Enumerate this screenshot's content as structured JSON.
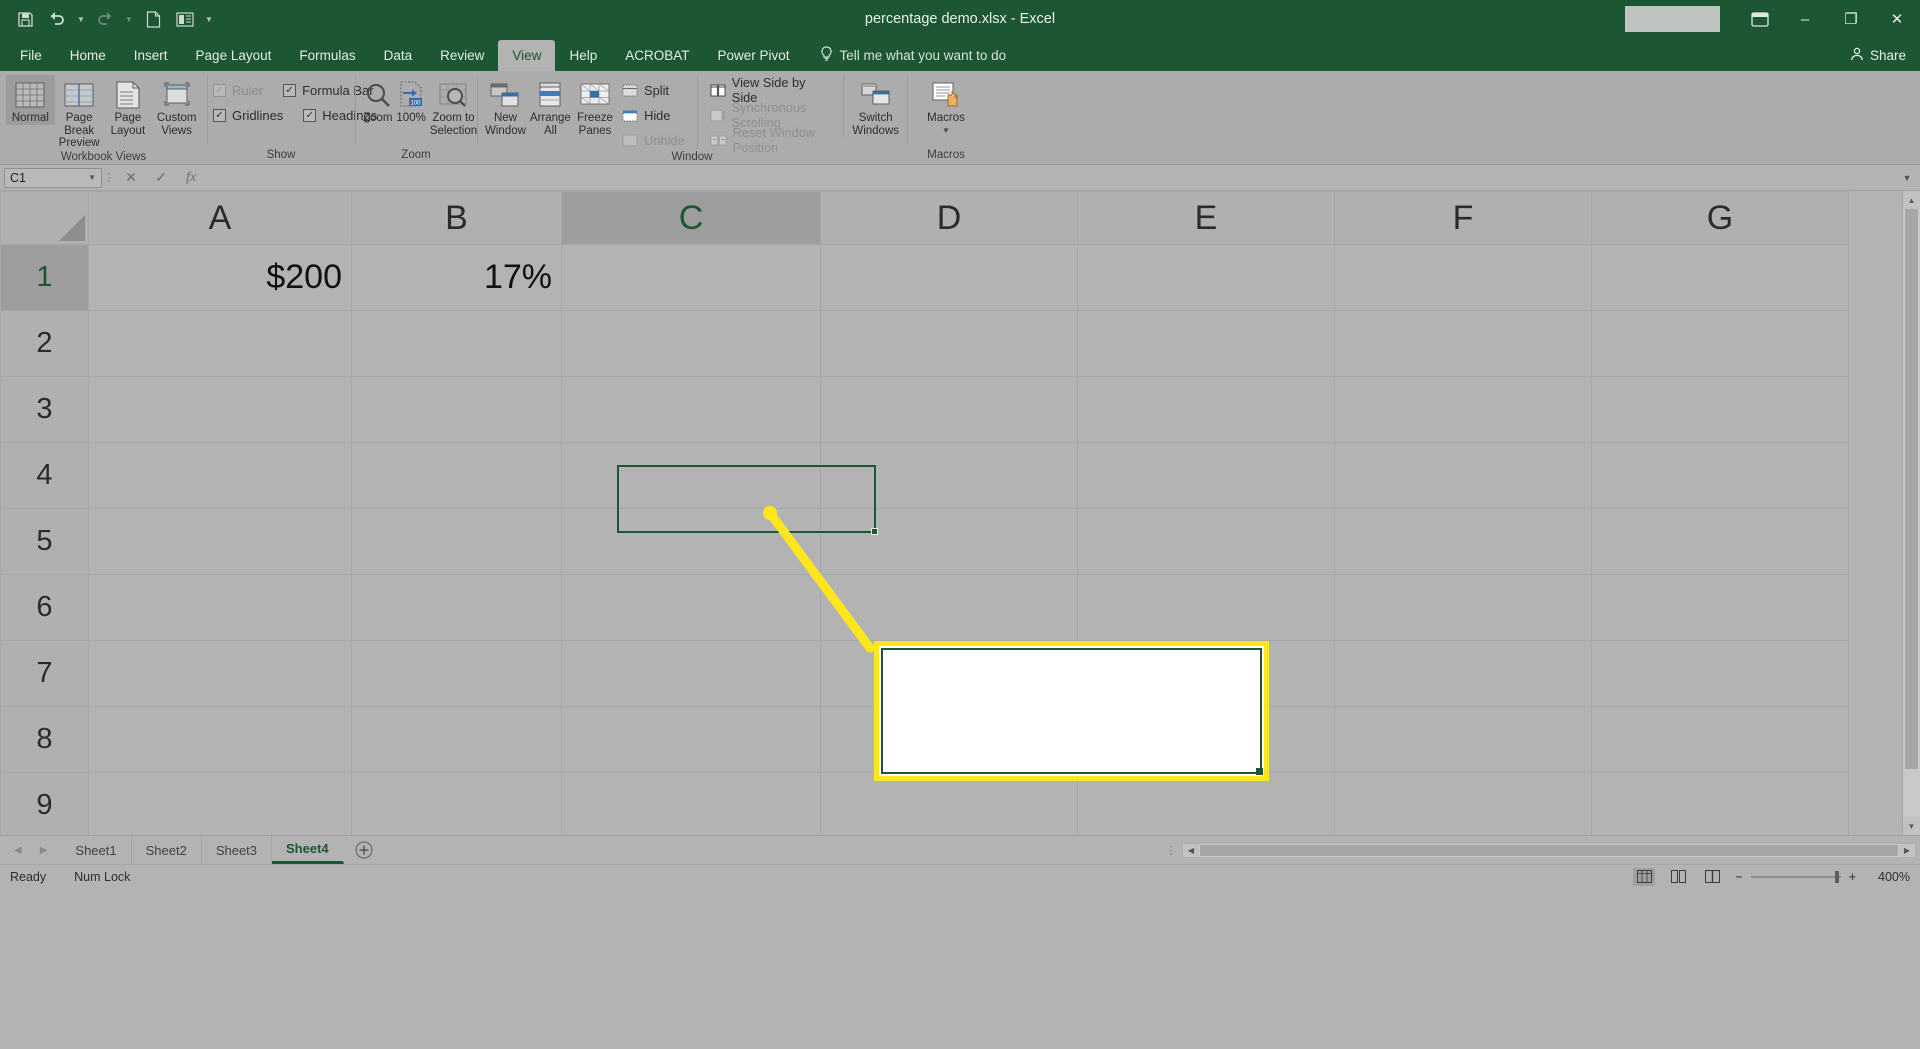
{
  "window": {
    "doc_title": "percentage demo.xlsx  -  Excel",
    "minimize": "–",
    "restore": "❐",
    "close": "✕",
    "ribbon_display_icon": "ribbon-display-options"
  },
  "quick_access": {
    "items": [
      {
        "name": "save-icon",
        "label": "Save"
      },
      {
        "name": "undo-icon",
        "label": "Undo"
      },
      {
        "name": "redo-icon",
        "label": "Redo"
      },
      {
        "name": "new-icon",
        "label": "New"
      },
      {
        "name": "touch-mode-icon",
        "label": "Touch/Mouse Mode"
      },
      {
        "name": "customize-qat-icon",
        "label": "Customize Quick Access Toolbar"
      }
    ]
  },
  "ribbon_tabs": [
    {
      "label": "File",
      "active": false
    },
    {
      "label": "Home",
      "active": false
    },
    {
      "label": "Insert",
      "active": false
    },
    {
      "label": "Page Layout",
      "active": false
    },
    {
      "label": "Formulas",
      "active": false
    },
    {
      "label": "Data",
      "active": false
    },
    {
      "label": "Review",
      "active": false
    },
    {
      "label": "View",
      "active": true
    },
    {
      "label": "Help",
      "active": false
    },
    {
      "label": "ACROBAT",
      "active": false
    },
    {
      "label": "Power Pivot",
      "active": false
    }
  ],
  "tell_me": {
    "placeholder": "Tell me what you want to do"
  },
  "share": {
    "label": "Share"
  },
  "ribbon": {
    "groups": [
      {
        "label": "Workbook Views",
        "buttons": [
          {
            "label": "Normal",
            "icon": "normal-view-icon",
            "selected": true
          },
          {
            "label": "Page Break Preview",
            "icon": "page-break-preview-icon",
            "selected": false
          },
          {
            "label": "Page Layout",
            "icon": "page-layout-icon",
            "selected": false
          },
          {
            "label": "Custom Views",
            "icon": "custom-views-icon",
            "selected": false
          }
        ]
      },
      {
        "label": "Show",
        "checkboxes": [
          {
            "label": "Ruler",
            "checked": true,
            "disabled": true
          },
          {
            "label": "Formula Bar",
            "checked": true,
            "disabled": false
          },
          {
            "label": "Gridlines",
            "checked": true,
            "disabled": false
          },
          {
            "label": "Headings",
            "checked": true,
            "disabled": false
          }
        ]
      },
      {
        "label": "Zoom",
        "buttons": [
          {
            "label": "Zoom",
            "icon": "zoom-magnifier-icon",
            "selected": false
          },
          {
            "label": "100%",
            "icon": "zoom-100-icon",
            "selected": false
          },
          {
            "label": "Zoom to Selection",
            "icon": "zoom-to-selection-icon",
            "selected": false
          }
        ]
      },
      {
        "label": "Window",
        "buttons": [
          {
            "label": "New Window",
            "icon": "new-window-icon"
          },
          {
            "label": "Arrange All",
            "icon": "arrange-all-icon"
          },
          {
            "label": "Freeze Panes",
            "icon": "freeze-panes-icon",
            "dropdown": true
          }
        ],
        "small_buttons": [
          {
            "label": "Split",
            "icon": "split-icon",
            "disabled": false
          },
          {
            "label": "Hide",
            "icon": "hide-icon",
            "disabled": false
          },
          {
            "label": "Unhide",
            "icon": "unhide-icon",
            "disabled": true
          }
        ],
        "small_buttons2": [
          {
            "label": "View Side by Side",
            "icon": "view-side-by-side-icon",
            "disabled": false
          },
          {
            "label": "Synchronous Scrolling",
            "icon": "synchronous-scrolling-icon",
            "disabled": true
          },
          {
            "label": "Reset Window Position",
            "icon": "reset-window-position-icon",
            "disabled": true
          }
        ],
        "switch_windows": {
          "label": "Switch Windows",
          "icon": "switch-windows-icon",
          "dropdown": true
        }
      },
      {
        "label": "Macros",
        "buttons": [
          {
            "label": "Macros",
            "icon": "macros-icon",
            "dropdown": true
          }
        ]
      }
    ]
  },
  "formula_bar": {
    "name_box_value": "C1",
    "cancel_icon": "cancel-icon",
    "enter_icon": "enter-check-icon",
    "function_icon": "insert-function-icon",
    "formula_value": "",
    "expand_icon": "expand-formula-bar-icon"
  },
  "grid": {
    "columns": [
      "A",
      "B",
      "C",
      "D",
      "E",
      "F",
      "G"
    ],
    "active_column": "C",
    "rows": [
      "1",
      "2",
      "3",
      "4",
      "5",
      "6",
      "7",
      "8",
      "9"
    ],
    "active_row": "1",
    "cells": {
      "A1": "$200",
      "B1": "17%",
      "C1": ""
    },
    "selected_cell": "C1"
  },
  "callout": {
    "text": "",
    "border_color": "#ffe71c",
    "inner_border_color": "#1d5632",
    "leader_color": "#ffe71c"
  },
  "sheet_tabs": {
    "prev_icon": "prev-sheet-icon",
    "next_icon": "next-sheet-icon",
    "tabs": [
      {
        "label": "Sheet1",
        "active": false
      },
      {
        "label": "Sheet2",
        "active": false
      },
      {
        "label": "Sheet3",
        "active": false
      },
      {
        "label": "Sheet4",
        "active": true
      }
    ],
    "add_sheet_icon": "add-sheet-icon"
  },
  "status_bar": {
    "state": "Ready",
    "num_lock": "Num Lock",
    "views": [
      {
        "name": "normal-view-button",
        "active": true
      },
      {
        "name": "page-layout-view-button",
        "active": false
      },
      {
        "name": "page-break-preview-button",
        "active": false
      }
    ],
    "zoom_out": "−",
    "zoom_in": "+",
    "zoom_level": "400%"
  },
  "colors": {
    "brand_green": "#1d5632",
    "highlight_yellow": "#ffe71c",
    "app_gray": "#b3b3b3"
  }
}
